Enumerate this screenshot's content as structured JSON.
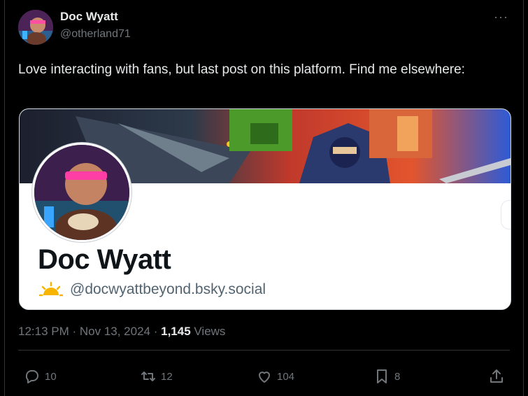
{
  "author": {
    "name": "Doc Wyatt",
    "handle": "@otherland71"
  },
  "menu": {
    "more_label": "···"
  },
  "post": {
    "text": "Love interacting with fans, but last post on this platform. Find me elsewhere:"
  },
  "card": {
    "name": "Doc Wyatt",
    "handle": "@docwyattbeyond.bsky.social"
  },
  "meta": {
    "time": "12:13 PM",
    "sep1": " · ",
    "date": "Nov 13, 2024",
    "sep2": " · ",
    "views_count": "1,145",
    "views_label": " Views"
  },
  "actions": {
    "replies": "10",
    "reposts": "12",
    "likes": "104",
    "bookmarks": "8"
  },
  "icons": [
    "avatar",
    "more-icon",
    "sun-icon",
    "reply-icon",
    "repost-icon",
    "like-icon",
    "bookmark-icon",
    "share-icon"
  ],
  "colors": {
    "background": "#000000",
    "text": "#e7e9ea",
    "muted": "#71767b",
    "card_bg": "#ffffff",
    "card_handle": "#536471",
    "sun": "#f7b500"
  }
}
